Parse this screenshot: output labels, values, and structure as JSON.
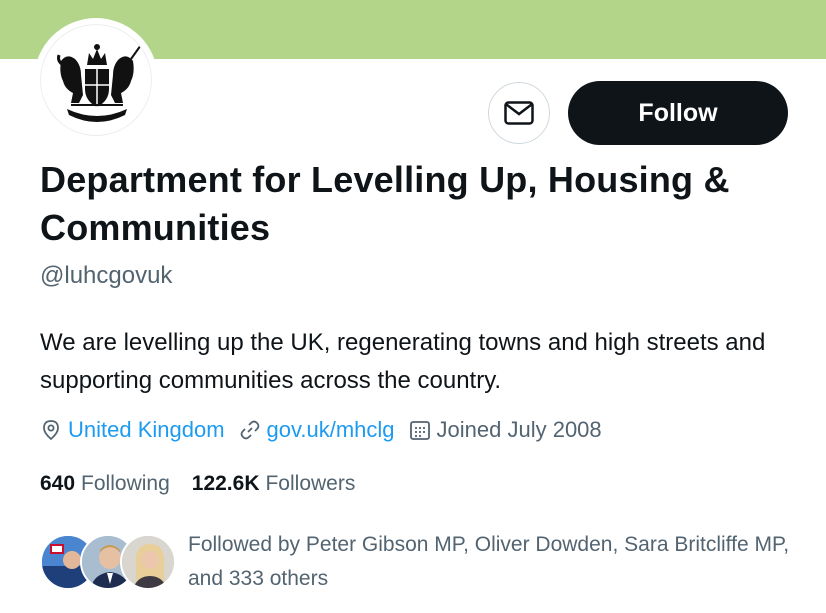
{
  "profile": {
    "name": "Department for Levelling Up, Housing & Communities",
    "handle": "@luhcgovuk",
    "bio": "We are levelling up the UK, regenerating towns and high streets and supporting communities across the country.",
    "location": "United Kingdom",
    "website": "gov.uk/mhclg",
    "joined": "Joined July 2008"
  },
  "actions": {
    "follow_label": "Follow"
  },
  "stats": {
    "following_count": "640",
    "following_label": "Following",
    "followers_count": "122.6K",
    "followers_label": "Followers"
  },
  "followed_by": {
    "text": "Followed by Peter Gibson MP, Oliver Dowden, Sara Britcliffe MP, and 333 others"
  },
  "colors": {
    "banner": "#b3d58a",
    "link": "#1d9bf0",
    "secondary_text": "#536471",
    "primary_text": "#0f1419"
  }
}
